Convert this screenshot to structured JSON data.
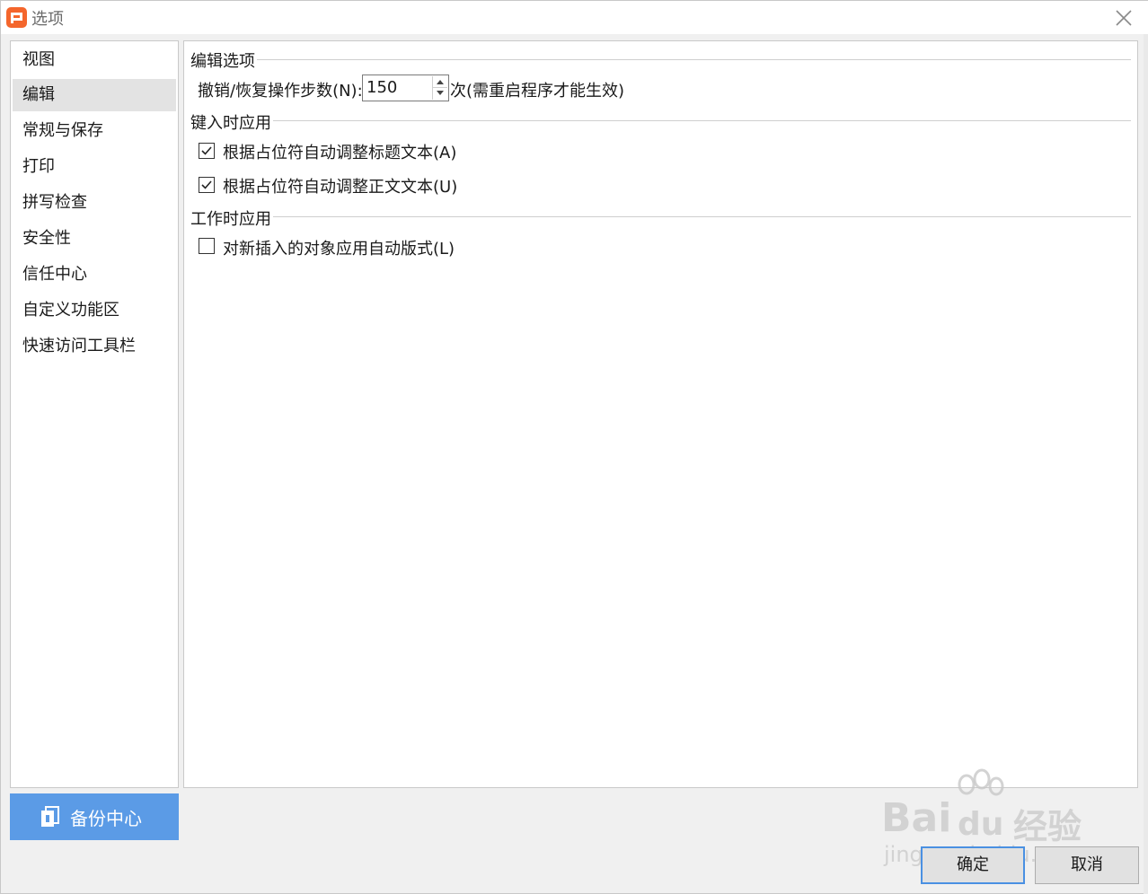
{
  "window": {
    "title": "选项"
  },
  "nav": {
    "items": [
      {
        "label": "视图"
      },
      {
        "label": "编辑"
      },
      {
        "label": "常规与保存"
      },
      {
        "label": "打印"
      },
      {
        "label": "拼写检查"
      },
      {
        "label": "安全性"
      },
      {
        "label": "信任中心"
      },
      {
        "label": "自定义功能区"
      },
      {
        "label": "快速访问工具栏"
      }
    ],
    "active_index": 1
  },
  "backup": {
    "label": "备份中心"
  },
  "sections": {
    "edit_options": {
      "title": "编辑选项",
      "undo_label": "撤销/恢复操作步数(N):",
      "undo_value": "150",
      "undo_suffix": "次(需重启程序才能生效)"
    },
    "apply_as_type": {
      "title": "键入时应用",
      "options": [
        {
          "label": "根据占位符自动调整标题文本(A)",
          "checked": true
        },
        {
          "label": "根据占位符自动调整正文文本(U)",
          "checked": true
        }
      ]
    },
    "apply_as_work": {
      "title": "工作时应用",
      "options": [
        {
          "label": "对新插入的对象应用自动版式(L)",
          "checked": false
        }
      ]
    }
  },
  "buttons": {
    "ok": "确定",
    "cancel": "取消"
  },
  "watermark": {
    "brand": "Bai",
    "brand2": "du",
    "cn": "经验",
    "url": "jingyan.baidu.com"
  },
  "colors": {
    "accent": "#5b9be6",
    "app_icon": "#f4662c",
    "ok_border": "#4a90e2"
  }
}
